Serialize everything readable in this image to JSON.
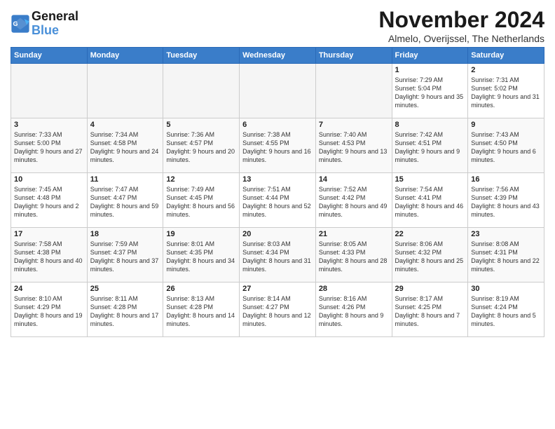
{
  "logo": {
    "line1": "General",
    "line2": "Blue"
  },
  "title": "November 2024",
  "location": "Almelo, Overijssel, The Netherlands",
  "headers": [
    "Sunday",
    "Monday",
    "Tuesday",
    "Wednesday",
    "Thursday",
    "Friday",
    "Saturday"
  ],
  "weeks": [
    [
      {
        "day": "",
        "info": ""
      },
      {
        "day": "",
        "info": ""
      },
      {
        "day": "",
        "info": ""
      },
      {
        "day": "",
        "info": ""
      },
      {
        "day": "",
        "info": ""
      },
      {
        "day": "1",
        "info": "Sunrise: 7:29 AM\nSunset: 5:04 PM\nDaylight: 9 hours and 35 minutes."
      },
      {
        "day": "2",
        "info": "Sunrise: 7:31 AM\nSunset: 5:02 PM\nDaylight: 9 hours and 31 minutes."
      }
    ],
    [
      {
        "day": "3",
        "info": "Sunrise: 7:33 AM\nSunset: 5:00 PM\nDaylight: 9 hours and 27 minutes."
      },
      {
        "day": "4",
        "info": "Sunrise: 7:34 AM\nSunset: 4:58 PM\nDaylight: 9 hours and 24 minutes."
      },
      {
        "day": "5",
        "info": "Sunrise: 7:36 AM\nSunset: 4:57 PM\nDaylight: 9 hours and 20 minutes."
      },
      {
        "day": "6",
        "info": "Sunrise: 7:38 AM\nSunset: 4:55 PM\nDaylight: 9 hours and 16 minutes."
      },
      {
        "day": "7",
        "info": "Sunrise: 7:40 AM\nSunset: 4:53 PM\nDaylight: 9 hours and 13 minutes."
      },
      {
        "day": "8",
        "info": "Sunrise: 7:42 AM\nSunset: 4:51 PM\nDaylight: 9 hours and 9 minutes."
      },
      {
        "day": "9",
        "info": "Sunrise: 7:43 AM\nSunset: 4:50 PM\nDaylight: 9 hours and 6 minutes."
      }
    ],
    [
      {
        "day": "10",
        "info": "Sunrise: 7:45 AM\nSunset: 4:48 PM\nDaylight: 9 hours and 2 minutes."
      },
      {
        "day": "11",
        "info": "Sunrise: 7:47 AM\nSunset: 4:47 PM\nDaylight: 8 hours and 59 minutes."
      },
      {
        "day": "12",
        "info": "Sunrise: 7:49 AM\nSunset: 4:45 PM\nDaylight: 8 hours and 56 minutes."
      },
      {
        "day": "13",
        "info": "Sunrise: 7:51 AM\nSunset: 4:44 PM\nDaylight: 8 hours and 52 minutes."
      },
      {
        "day": "14",
        "info": "Sunrise: 7:52 AM\nSunset: 4:42 PM\nDaylight: 8 hours and 49 minutes."
      },
      {
        "day": "15",
        "info": "Sunrise: 7:54 AM\nSunset: 4:41 PM\nDaylight: 8 hours and 46 minutes."
      },
      {
        "day": "16",
        "info": "Sunrise: 7:56 AM\nSunset: 4:39 PM\nDaylight: 8 hours and 43 minutes."
      }
    ],
    [
      {
        "day": "17",
        "info": "Sunrise: 7:58 AM\nSunset: 4:38 PM\nDaylight: 8 hours and 40 minutes."
      },
      {
        "day": "18",
        "info": "Sunrise: 7:59 AM\nSunset: 4:37 PM\nDaylight: 8 hours and 37 minutes."
      },
      {
        "day": "19",
        "info": "Sunrise: 8:01 AM\nSunset: 4:35 PM\nDaylight: 8 hours and 34 minutes."
      },
      {
        "day": "20",
        "info": "Sunrise: 8:03 AM\nSunset: 4:34 PM\nDaylight: 8 hours and 31 minutes."
      },
      {
        "day": "21",
        "info": "Sunrise: 8:05 AM\nSunset: 4:33 PM\nDaylight: 8 hours and 28 minutes."
      },
      {
        "day": "22",
        "info": "Sunrise: 8:06 AM\nSunset: 4:32 PM\nDaylight: 8 hours and 25 minutes."
      },
      {
        "day": "23",
        "info": "Sunrise: 8:08 AM\nSunset: 4:31 PM\nDaylight: 8 hours and 22 minutes."
      }
    ],
    [
      {
        "day": "24",
        "info": "Sunrise: 8:10 AM\nSunset: 4:29 PM\nDaylight: 8 hours and 19 minutes."
      },
      {
        "day": "25",
        "info": "Sunrise: 8:11 AM\nSunset: 4:28 PM\nDaylight: 8 hours and 17 minutes."
      },
      {
        "day": "26",
        "info": "Sunrise: 8:13 AM\nSunset: 4:28 PM\nDaylight: 8 hours and 14 minutes."
      },
      {
        "day": "27",
        "info": "Sunrise: 8:14 AM\nSunset: 4:27 PM\nDaylight: 8 hours and 12 minutes."
      },
      {
        "day": "28",
        "info": "Sunrise: 8:16 AM\nSunset: 4:26 PM\nDaylight: 8 hours and 9 minutes."
      },
      {
        "day": "29",
        "info": "Sunrise: 8:17 AM\nSunset: 4:25 PM\nDaylight: 8 hours and 7 minutes."
      },
      {
        "day": "30",
        "info": "Sunrise: 8:19 AM\nSunset: 4:24 PM\nDaylight: 8 hours and 5 minutes."
      }
    ]
  ]
}
